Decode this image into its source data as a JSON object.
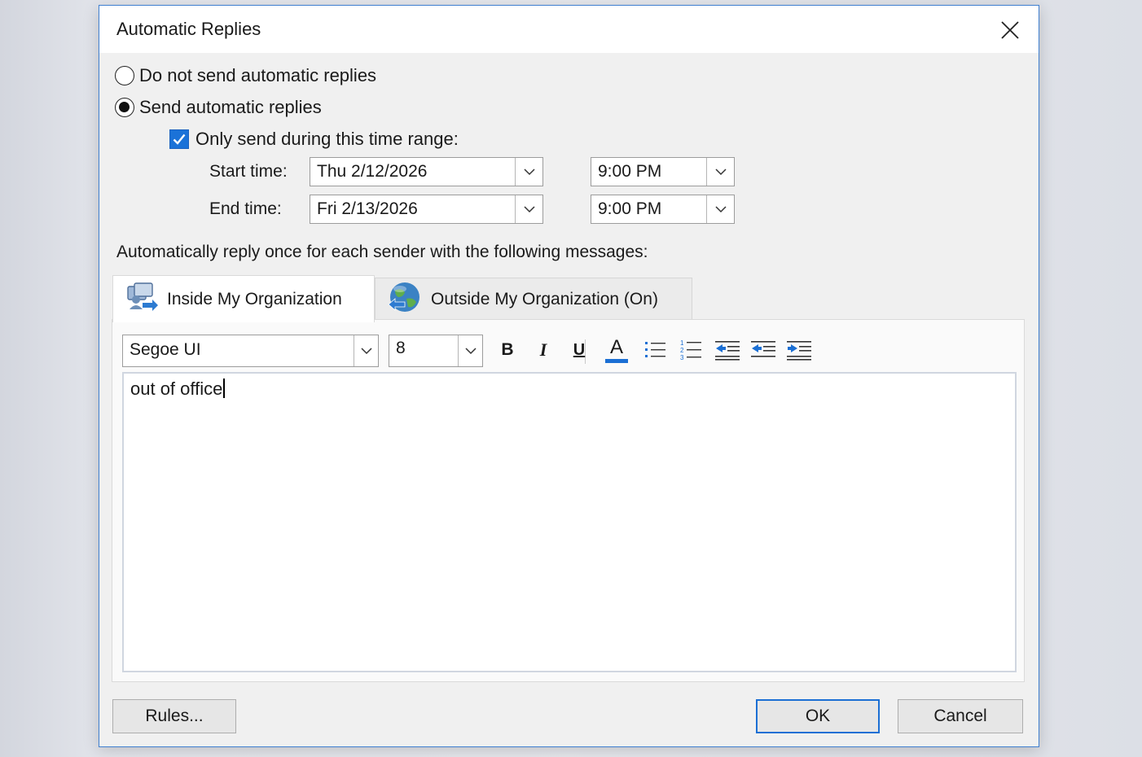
{
  "dialog": {
    "title": "Automatic Replies"
  },
  "options": {
    "no_reply_label": "Do not send automatic replies",
    "send_reply_label": "Send automatic replies",
    "selected": "send",
    "time_range_label": "Only send during this time range:",
    "time_range_checked": true
  },
  "schedule": {
    "start_label": "Start time:",
    "start_date": "Thu 2/12/2026",
    "start_time": "9:00 PM",
    "end_label": "End time:",
    "end_date": "Fri 2/13/2026",
    "end_time": "9:00 PM"
  },
  "instructions": "Automatically reply once for each sender with the following messages:",
  "tabs": [
    {
      "label": "Inside My Organization",
      "icon": "people-arrow-icon",
      "active": true
    },
    {
      "label": "Outside My Organization (On)",
      "icon": "globe-arrow-icon",
      "active": false
    }
  ],
  "format_toolbar": {
    "font": "Segoe UI",
    "size": "8",
    "bold": "B",
    "italic": "I",
    "underline": "U",
    "font_color": "A",
    "font_color_value": "#1b6fd4"
  },
  "message": {
    "text": "out of office"
  },
  "buttons": {
    "rules": "Rules...",
    "ok": "OK",
    "cancel": "Cancel"
  },
  "colors": {
    "accent": "#1b72d8",
    "dialog_border": "#3f7fd0"
  }
}
